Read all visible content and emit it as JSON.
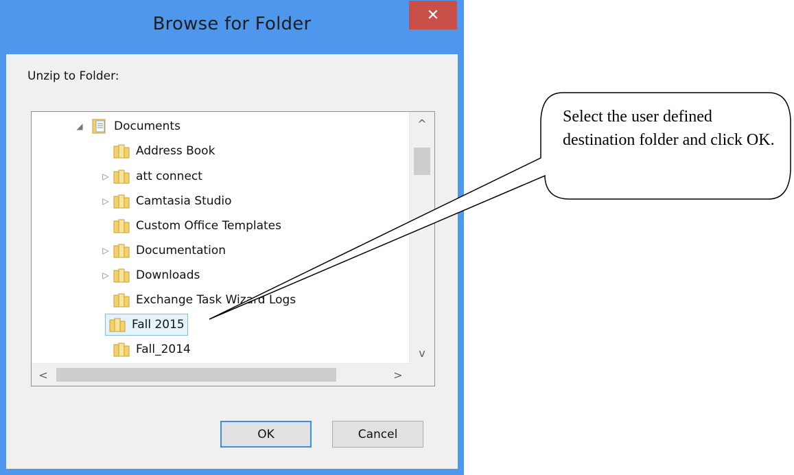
{
  "dialog": {
    "title": "Browse for Folder",
    "close_glyph": "✕",
    "prompt": "Unzip to Folder:"
  },
  "tree": {
    "root": {
      "label": "Documents",
      "expanded": true,
      "icon": "documents-folder-icon"
    },
    "items": [
      {
        "label": "Address Book",
        "has_children": false,
        "selected": false
      },
      {
        "label": "att connect",
        "has_children": true,
        "selected": false
      },
      {
        "label": "Camtasia Studio",
        "has_children": true,
        "selected": false
      },
      {
        "label": "Custom Office Templates",
        "has_children": false,
        "selected": false
      },
      {
        "label": "Documentation",
        "has_children": true,
        "selected": false
      },
      {
        "label": "Downloads",
        "has_children": true,
        "selected": false
      },
      {
        "label": "Exchange Task Wizard Logs",
        "has_children": false,
        "selected": false
      },
      {
        "label": "Fall 2015",
        "has_children": false,
        "selected": true
      },
      {
        "label": "Fall_2014",
        "has_children": false,
        "selected": false
      }
    ]
  },
  "scroll_glyphs": {
    "up": "^",
    "down": "v",
    "left": "<",
    "right": ">"
  },
  "buttons": {
    "ok": "OK",
    "cancel": "Cancel"
  },
  "callout": {
    "text": "Select the user defined destination folder and click OK."
  },
  "colors": {
    "window_frame": "#4f97ec",
    "close_button": "#c85048",
    "selection_fill": "#e5f3fb",
    "selection_border": "#7fbde8",
    "folder_yellow": "#f4d269"
  }
}
